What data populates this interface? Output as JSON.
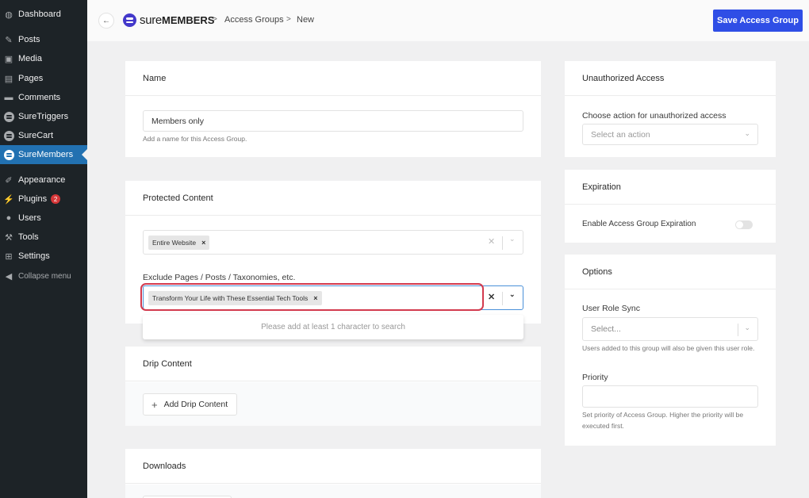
{
  "sidebar": {
    "items": [
      {
        "label": "Dashboard",
        "icon": "dashboard-icon"
      },
      {
        "label": "Posts",
        "icon": "pin-icon"
      },
      {
        "label": "Media",
        "icon": "media-icon"
      },
      {
        "label": "Pages",
        "icon": "pages-icon"
      },
      {
        "label": "Comments",
        "icon": "comment-icon"
      },
      {
        "label": "SureTriggers",
        "icon": "suretriggers-icon"
      },
      {
        "label": "SureCart",
        "icon": "surecart-icon"
      },
      {
        "label": "SureMembers",
        "icon": "suremembers-icon",
        "active": true
      },
      {
        "label": "Appearance",
        "icon": "brush-icon"
      },
      {
        "label": "Plugins",
        "icon": "plugin-icon",
        "badge": "2"
      },
      {
        "label": "Users",
        "icon": "user-icon"
      },
      {
        "label": "Tools",
        "icon": "wrench-icon"
      },
      {
        "label": "Settings",
        "icon": "settings-icon"
      },
      {
        "label": "Collapse menu",
        "icon": "collapse-icon"
      }
    ]
  },
  "header": {
    "back_icon": "←",
    "logo_sure": "sure",
    "logo_members": "MEMBERS",
    "breadcrumb": [
      "Access Groups",
      "New"
    ],
    "breadcrumb_sep": ">",
    "save_label": "Save Access Group",
    "accent_color": "#2f4ee6"
  },
  "name_card": {
    "title": "Name",
    "value": "Members only",
    "help": "Add a name for this Access Group."
  },
  "protected_card": {
    "title": "Protected Content",
    "include_tags": [
      "Entire Website"
    ],
    "exclude_label": "Exclude Pages / Posts / Taxonomies, etc.",
    "exclude_tags": [
      "Transform Your Life with These Essential Tech Tools"
    ],
    "dropdown_message": "Please add at least 1 character to search",
    "clear_glyph": "✕",
    "chevron_glyph": "⌄",
    "tag_remove_glyph": "×"
  },
  "drip_card": {
    "title": "Drip Content",
    "add_label": "Add Drip Content",
    "add_icon": "+"
  },
  "downloads_card": {
    "title": "Downloads"
  },
  "unauth_card": {
    "title": "Unauthorized Access",
    "label": "Choose action for unauthorized access",
    "placeholder": "Select an action"
  },
  "expiration_card": {
    "title": "Expiration",
    "toggle_label": "Enable Access Group Expiration",
    "enabled": false
  },
  "options_card": {
    "title": "Options",
    "role_label": "User Role Sync",
    "role_placeholder": "Select...",
    "role_help": "Users added to this group will also be given this user role.",
    "priority_label": "Priority",
    "priority_value": "",
    "priority_help": "Set priority of Access Group. Higher the priority will be executed first."
  }
}
